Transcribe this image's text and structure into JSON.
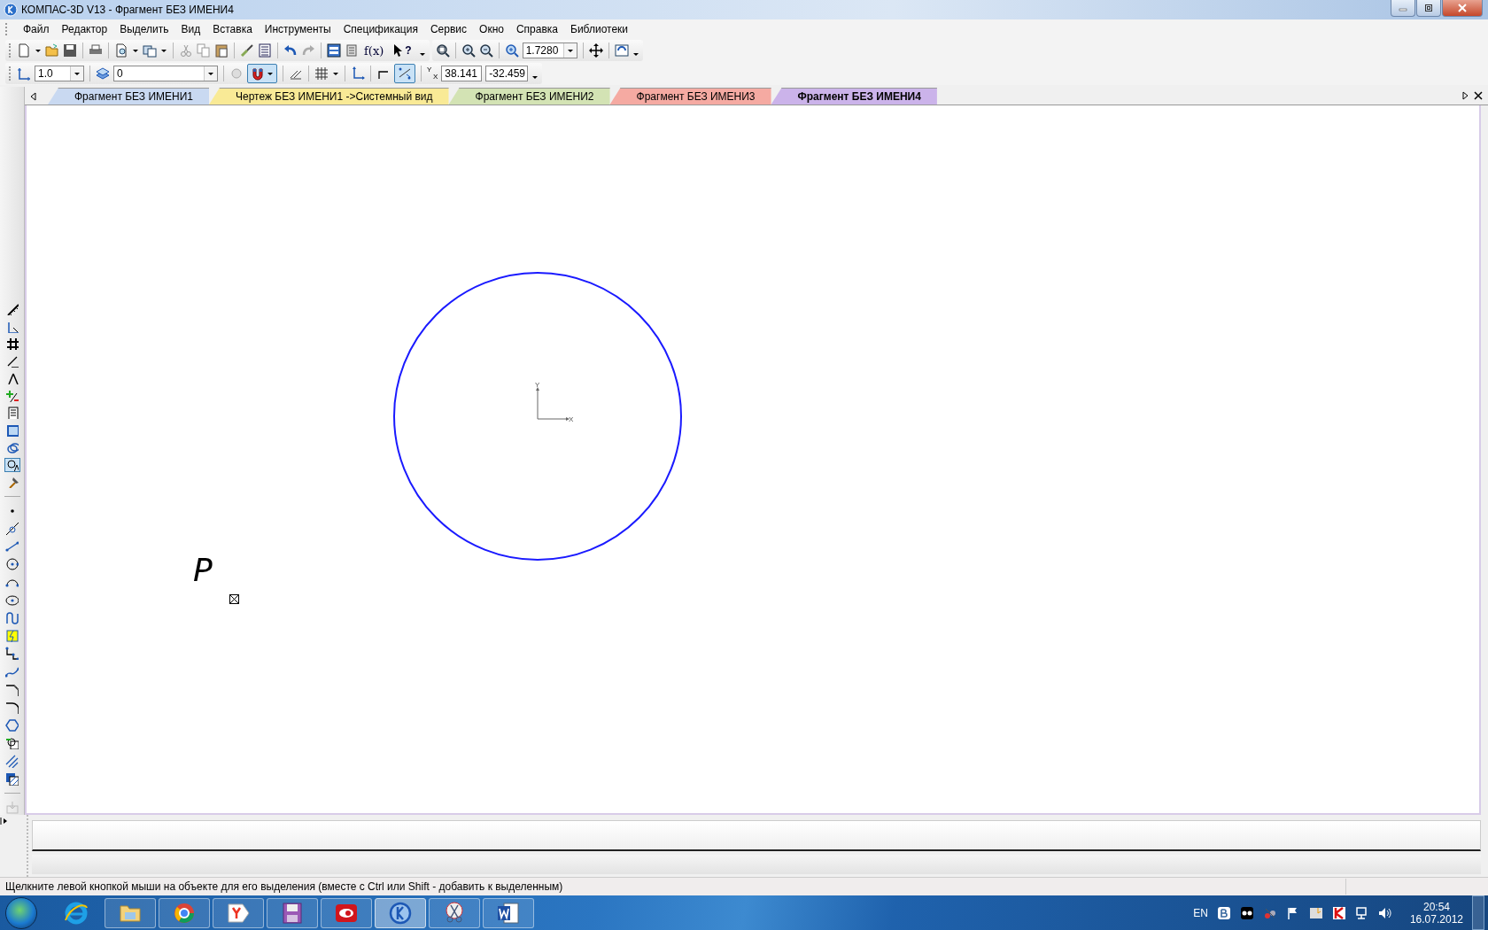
{
  "window": {
    "title": "КОМПАС-3D V13 - Фрагмент БЕЗ ИМЕНИ4"
  },
  "menu": [
    {
      "label": "Файл"
    },
    {
      "label": "Редактор"
    },
    {
      "label": "Выделить"
    },
    {
      "label": "Вид"
    },
    {
      "label": "Вставка"
    },
    {
      "label": "Инструменты"
    },
    {
      "label": "Спецификация"
    },
    {
      "label": "Сервис"
    },
    {
      "label": "Окно"
    },
    {
      "label": "Справка"
    },
    {
      "label": "Библиотеки"
    }
  ],
  "standard_toolbar": {
    "variables_button": "f(x)",
    "help_button": "?",
    "zoom_field": "1.7280"
  },
  "current_state_toolbar": {
    "line_step_field": "1.0",
    "layer_field": "0",
    "snapping_on": true,
    "local_snap_on": true,
    "coord_label_y": "Y",
    "coord_label_x": "X",
    "cursor_x_field": "38.141",
    "cursor_y_field": "-32.459"
  },
  "tabs": [
    {
      "label": "Фрагмент БЕЗ ИМЕНИ1",
      "selected": false,
      "color": "#c9d9f1"
    },
    {
      "label": "Чертеж БЕЗ ИМЕНИ1 ->Системный вид",
      "selected": false,
      "color": "#f9ea96"
    },
    {
      "label": "Фрагмент БЕЗ ИМЕНИ2",
      "selected": false,
      "color": "#d3e3b4"
    },
    {
      "label": "Фрагмент БЕЗ ИМЕНИ3",
      "selected": false,
      "color": "#f5aaa2"
    },
    {
      "label": "Фрагмент БЕЗ ИМЕНИ4",
      "selected": true,
      "color": "#cbb3ea"
    }
  ],
  "sidebar": {
    "panels": [
      {
        "selected": false
      },
      {
        "selected": false
      },
      {
        "selected": false
      },
      {
        "selected": false
      },
      {
        "selected": false
      },
      {
        "selected": false
      },
      {
        "selected": false
      },
      {
        "selected": false
      },
      {
        "selected": false
      },
      {
        "selected": true
      },
      {
        "selected": false
      }
    ]
  },
  "canvas": {
    "axis_y": "Y",
    "axis_x": "X",
    "point_label": "P"
  },
  "status_bar": {
    "hint": "Щелкните левой кнопкой мыши на объекте для его выделения (вместе с Ctrl или Shift - добавить к выделенным)"
  },
  "taskbar": {
    "apps": [
      {
        "selected": false
      },
      {
        "selected": false
      },
      {
        "selected": false
      },
      {
        "selected": false
      },
      {
        "selected": false
      },
      {
        "selected": false
      },
      {
        "selected": true
      },
      {
        "selected": false
      },
      {
        "selected": false
      }
    ],
    "language": "EN",
    "time": "20:54",
    "date": "16.07.2012"
  }
}
